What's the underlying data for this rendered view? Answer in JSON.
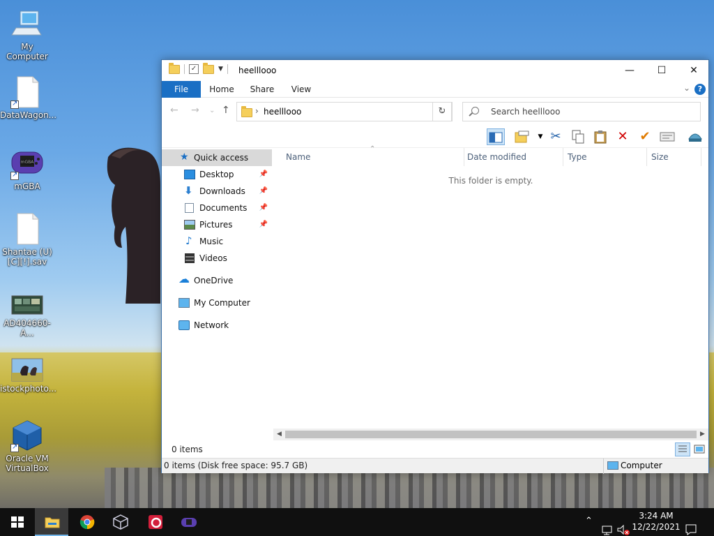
{
  "desktop": {
    "icons": [
      {
        "label": "My Computer"
      },
      {
        "label": "DataWagon..."
      },
      {
        "label": "mGBA"
      },
      {
        "label": "Shantae (U) [C][!].sav"
      },
      {
        "label": "AD404660- A..."
      },
      {
        "label": "istockphoto..."
      },
      {
        "label": "Oracle VM VirtualBox"
      }
    ]
  },
  "window": {
    "title": "heelllooo",
    "ribbon_tabs": [
      "File",
      "Home",
      "Share",
      "View"
    ],
    "help_glyph": "?",
    "address": {
      "crumb": "heelllooo"
    },
    "search": {
      "placeholder": "Search heelllooo"
    },
    "nav": {
      "quick_access": "Quick access",
      "items": [
        {
          "label": "Desktop",
          "pinned": true
        },
        {
          "label": "Downloads",
          "pinned": true
        },
        {
          "label": "Documents",
          "pinned": true
        },
        {
          "label": "Pictures",
          "pinned": true
        },
        {
          "label": "Music",
          "pinned": false
        },
        {
          "label": "Videos",
          "pinned": false
        }
      ],
      "onedrive": "OneDrive",
      "my_computer": "My Computer",
      "network": "Network"
    },
    "columns": [
      "Name",
      "Date modified",
      "Type",
      "Size"
    ],
    "empty_message": "This folder is empty.",
    "status_items": "0 items",
    "status_detail": "0 items (Disk free space: 95.7 GB)",
    "status_location": "Computer"
  },
  "taskbar": {
    "time": "3:24 AM",
    "date": "12/22/2021"
  },
  "colors": {
    "accent": "#1a6fc4",
    "taskbar": "#101010",
    "selected_nav": "#d9d9d9"
  }
}
